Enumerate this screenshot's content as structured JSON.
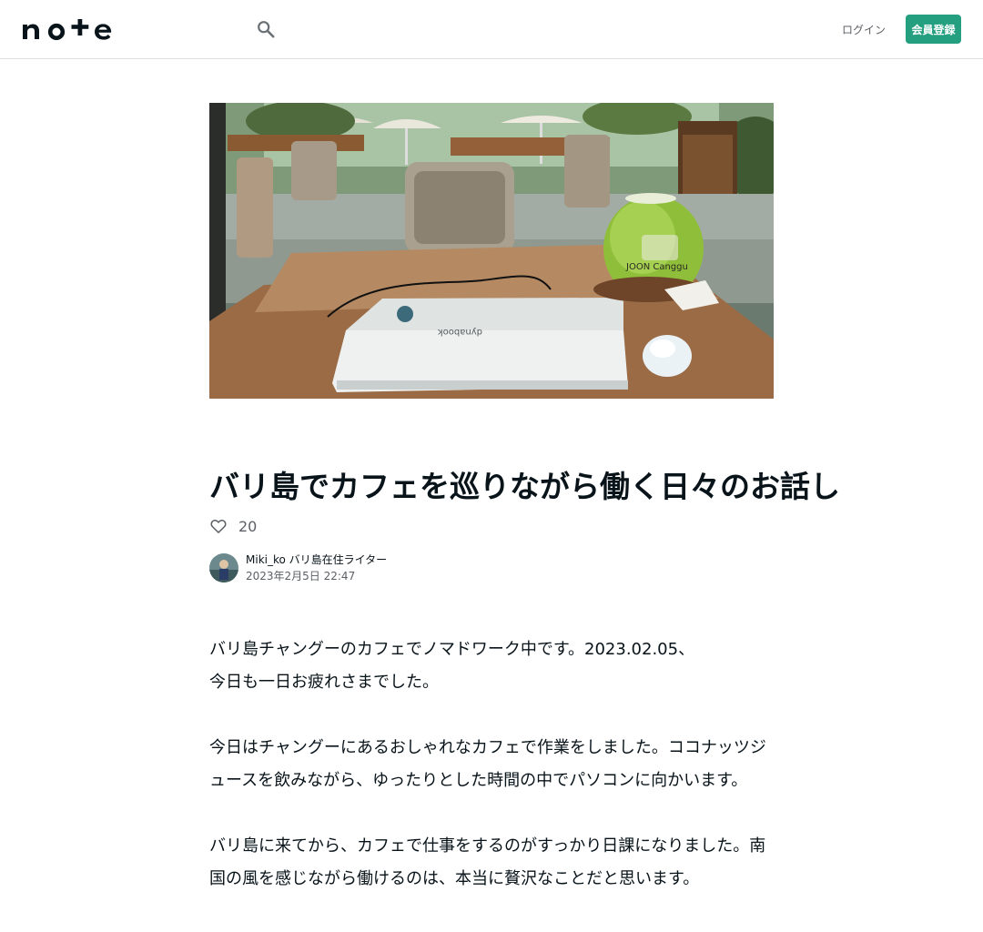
{
  "header": {
    "logo_text": "note",
    "search_icon": "search-icon",
    "login_label": "ログイン",
    "signup_label": "会員登録",
    "accent_color": "#249f80"
  },
  "hero": {
    "icon": "hero-image",
    "cup_text": "JOON Canggu",
    "laptop_text": "dynabook"
  },
  "article": {
    "title": "バリ島でカフェを巡りながら働く日々のお話し",
    "like_icon": "heart-icon",
    "like_count": "20",
    "author_name": "Miki_ko バリ島在住ライター",
    "post_date": "2023年2月5日 22:47",
    "paragraphs": [
      "バリ島チャングーのカフェでノマドワーク中です。2023.02.05、",
      "今日も一日お疲れさまでした。",
      "今日はチャングーにあるおしゃれなカフェで作業をしました。ココナッツジュースを飲みながら、ゆったりとした時間の中でパソコンに向かいます。",
      "バリ島に来てから、カフェで仕事をするのがすっかり日課になりました。南国の風を感じながら働けるのは、本当に贅沢なことだと思います。"
    ]
  }
}
